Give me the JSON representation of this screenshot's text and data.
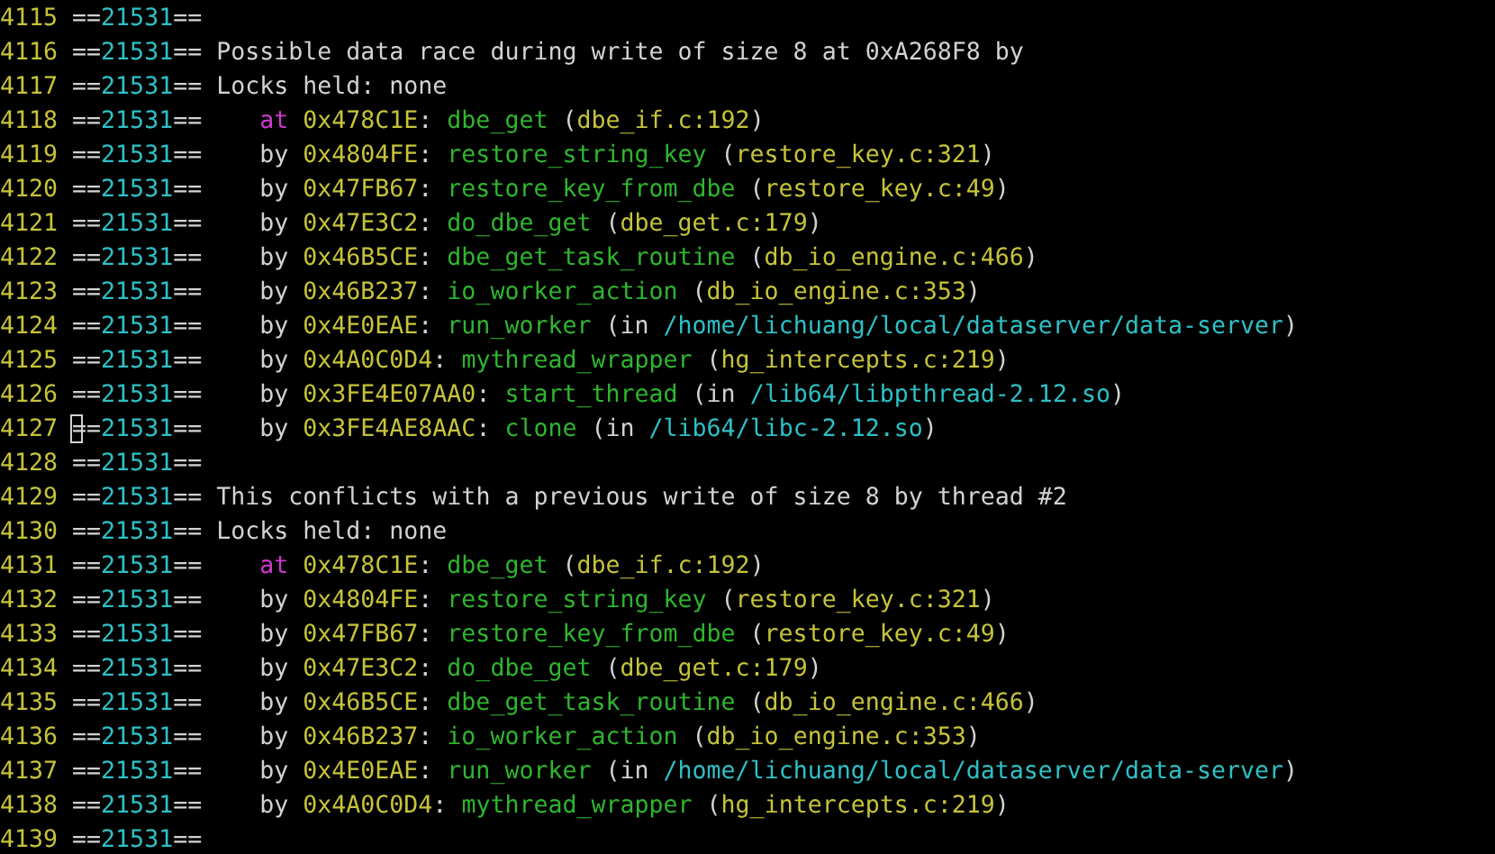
{
  "terminal": {
    "lines": [
      {
        "number": "4115",
        "pid": [
          "==",
          "21531",
          "=="
        ],
        "cursor": false,
        "kind": "blank"
      },
      {
        "number": "4116",
        "pid": [
          "==",
          "21531",
          "=="
        ],
        "cursor": false,
        "kind": "message",
        "text": "Possible data race during write of size 8 at 0xA268F8 by"
      },
      {
        "number": "4117",
        "pid": [
          "==",
          "21531",
          "=="
        ],
        "cursor": false,
        "kind": "message",
        "text": "Locks held: none"
      },
      {
        "number": "4118",
        "pid": [
          "==",
          "21531",
          "=="
        ],
        "cursor": false,
        "kind": "frame",
        "keyword": "at",
        "top_frame": true,
        "address": "0x478C1E:",
        "function": "dbe_get",
        "location": "(dbe_if.c:192)"
      },
      {
        "number": "4119",
        "pid": [
          "==",
          "21531",
          "=="
        ],
        "cursor": false,
        "kind": "frame",
        "keyword": "by",
        "top_frame": false,
        "address": "0x4804FE:",
        "function": "restore_string_key",
        "location": "(restore_key.c:321)"
      },
      {
        "number": "4120",
        "pid": [
          "==",
          "21531",
          "=="
        ],
        "cursor": false,
        "kind": "frame",
        "keyword": "by",
        "top_frame": false,
        "address": "0x47FB67:",
        "function": "restore_key_from_dbe",
        "location": "(restore_key.c:49)"
      },
      {
        "number": "4121",
        "pid": [
          "==",
          "21531",
          "=="
        ],
        "cursor": false,
        "kind": "frame",
        "keyword": "by",
        "top_frame": false,
        "address": "0x47E3C2:",
        "function": "do_dbe_get",
        "location": "(dbe_get.c:179)"
      },
      {
        "number": "4122",
        "pid": [
          "==",
          "21531",
          "=="
        ],
        "cursor": false,
        "kind": "frame",
        "keyword": "by",
        "top_frame": false,
        "address": "0x46B5CE:",
        "function": "dbe_get_task_routine",
        "location": "(db_io_engine.c:466)"
      },
      {
        "number": "4123",
        "pid": [
          "==",
          "21531",
          "=="
        ],
        "cursor": false,
        "kind": "frame",
        "keyword": "by",
        "top_frame": false,
        "address": "0x46B237:",
        "function": "io_worker_action",
        "location": "(db_io_engine.c:353)"
      },
      {
        "number": "4124",
        "pid": [
          "==",
          "21531",
          "=="
        ],
        "cursor": false,
        "kind": "frame",
        "keyword": "by",
        "top_frame": false,
        "address": "0x4E0EAE:",
        "function": "run_worker",
        "location_prefix": "(in",
        "path": "/home/lichuang/local/dataserver/data-server",
        "location_suffix": ")"
      },
      {
        "number": "4125",
        "pid": [
          "==",
          "21531",
          "=="
        ],
        "cursor": false,
        "kind": "frame",
        "keyword": "by",
        "top_frame": false,
        "address": "0x4A0C0D4:",
        "function": "mythread_wrapper",
        "location": "(hg_intercepts.c:219)"
      },
      {
        "number": "4126",
        "pid": [
          "==",
          "21531",
          "=="
        ],
        "cursor": false,
        "kind": "frame",
        "keyword": "by",
        "top_frame": false,
        "address": "0x3FE4E07AA0:",
        "function": "start_thread",
        "location_prefix": "(in",
        "path": "/lib64/libpthread-2.12.so",
        "location_suffix": ")"
      },
      {
        "number": "4127",
        "pid": [
          "==",
          "21531",
          "=="
        ],
        "cursor": true,
        "kind": "frame",
        "keyword": "by",
        "top_frame": false,
        "address": "0x3FE4AE8AAC:",
        "function": "clone",
        "location_prefix": "(in",
        "path": "/lib64/libc-2.12.so",
        "location_suffix": ")"
      },
      {
        "number": "4128",
        "pid": [
          "==",
          "21531",
          "=="
        ],
        "cursor": false,
        "kind": "blank"
      },
      {
        "number": "4129",
        "pid": [
          "==",
          "21531",
          "=="
        ],
        "cursor": false,
        "kind": "message",
        "text": "This conflicts with a previous write of size 8 by thread #2"
      },
      {
        "number": "4130",
        "pid": [
          "==",
          "21531",
          "=="
        ],
        "cursor": false,
        "kind": "message",
        "text": "Locks held: none"
      },
      {
        "number": "4131",
        "pid": [
          "==",
          "21531",
          "=="
        ],
        "cursor": false,
        "kind": "frame",
        "keyword": "at",
        "top_frame": true,
        "address": "0x478C1E:",
        "function": "dbe_get",
        "location": "(dbe_if.c:192)"
      },
      {
        "number": "4132",
        "pid": [
          "==",
          "21531",
          "=="
        ],
        "cursor": false,
        "kind": "frame",
        "keyword": "by",
        "top_frame": false,
        "address": "0x4804FE:",
        "function": "restore_string_key",
        "location": "(restore_key.c:321)"
      },
      {
        "number": "4133",
        "pid": [
          "==",
          "21531",
          "=="
        ],
        "cursor": false,
        "kind": "frame",
        "keyword": "by",
        "top_frame": false,
        "address": "0x47FB67:",
        "function": "restore_key_from_dbe",
        "location": "(restore_key.c:49)"
      },
      {
        "number": "4134",
        "pid": [
          "==",
          "21531",
          "=="
        ],
        "cursor": false,
        "kind": "frame",
        "keyword": "by",
        "top_frame": false,
        "address": "0x47E3C2:",
        "function": "do_dbe_get",
        "location": "(dbe_get.c:179)"
      },
      {
        "number": "4135",
        "pid": [
          "==",
          "21531",
          "=="
        ],
        "cursor": false,
        "kind": "frame",
        "keyword": "by",
        "top_frame": false,
        "address": "0x46B5CE:",
        "function": "dbe_get_task_routine",
        "location": "(db_io_engine.c:466)"
      },
      {
        "number": "4136",
        "pid": [
          "==",
          "21531",
          "=="
        ],
        "cursor": false,
        "kind": "frame",
        "keyword": "by",
        "top_frame": false,
        "address": "0x46B237:",
        "function": "io_worker_action",
        "location": "(db_io_engine.c:353)"
      },
      {
        "number": "4137",
        "pid": [
          "==",
          "21531",
          "=="
        ],
        "cursor": false,
        "kind": "frame",
        "keyword": "by",
        "top_frame": false,
        "address": "0x4E0EAE:",
        "function": "run_worker",
        "location_prefix": "(in",
        "path": "/home/lichuang/local/dataserver/data-server",
        "location_suffix": ")"
      },
      {
        "number": "4138",
        "pid": [
          "==",
          "21531",
          "=="
        ],
        "cursor": false,
        "kind": "frame",
        "keyword": "by",
        "top_frame": false,
        "address": "0x4A0C0D4:",
        "function": "mythread_wrapper",
        "location": "(hg_intercepts.c:219)"
      },
      {
        "number": "4139",
        "pid": [
          "==",
          "21531",
          "=="
        ],
        "cursor": false,
        "kind": "blank"
      }
    ]
  }
}
